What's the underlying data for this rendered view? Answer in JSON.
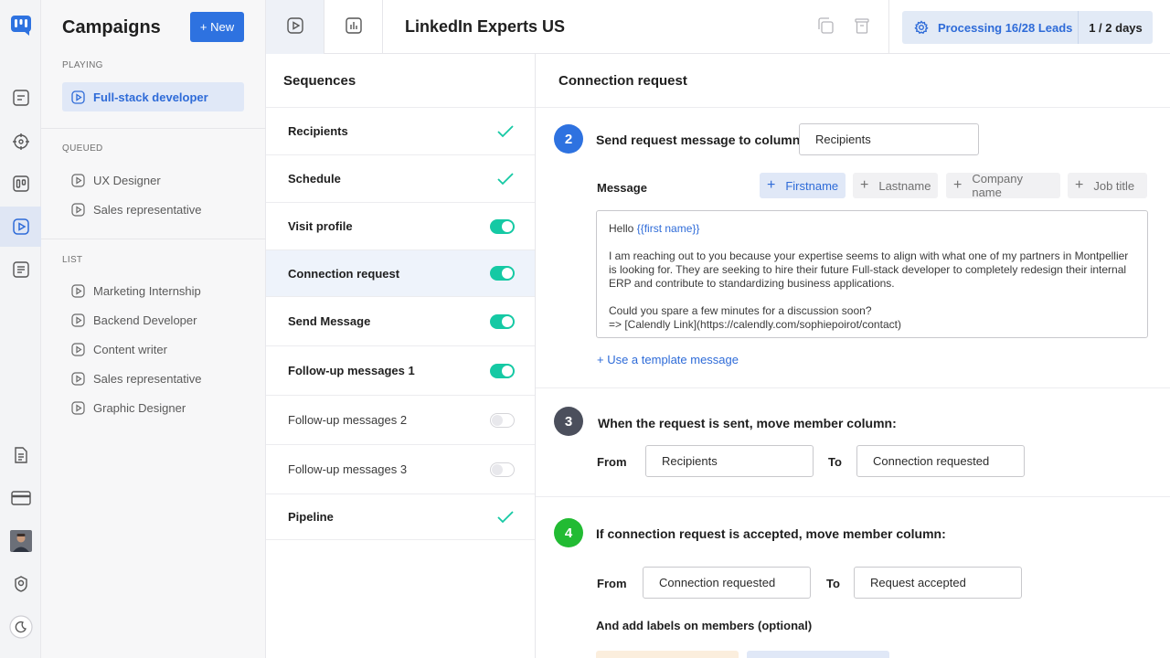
{
  "rail": {
    "icons": [
      "logo-icon",
      "messages-icon",
      "target-icon",
      "board-icon",
      "campaigns-icon",
      "list-icon",
      "documents-icon",
      "billing-icon",
      "avatar",
      "award-icon",
      "dark-mode-icon"
    ]
  },
  "campaigns": {
    "title": "Campaigns",
    "new_label": "+ New",
    "playing_label": "PLAYING",
    "playing": [
      "Full-stack developer"
    ],
    "queued_label": "QUEUED",
    "queued": [
      "UX Designer",
      "Sales representative"
    ],
    "list_label": "LIST",
    "list": [
      "Marketing Internship",
      "Backend Developer",
      "Content writer",
      "Sales representative",
      "Graphic Designer"
    ]
  },
  "topbar": {
    "title": "LinkedIn Experts US",
    "processing": "Processing 16/28 Leads",
    "days": "1 / 2 days"
  },
  "sequences": {
    "title": "Sequences",
    "items": [
      {
        "label": "Recipients",
        "state": "check"
      },
      {
        "label": "Schedule",
        "state": "check"
      },
      {
        "label": "Visit profile",
        "state": "on"
      },
      {
        "label": "Connection request",
        "state": "on"
      },
      {
        "label": "Send Message",
        "state": "on"
      },
      {
        "label": "Follow-up messages 1",
        "state": "on"
      },
      {
        "label": "Follow-up messages 2",
        "state": "off"
      },
      {
        "label": "Follow-up messages 3",
        "state": "off"
      },
      {
        "label": "Pipeline",
        "state": "check"
      }
    ]
  },
  "detail": {
    "title": "Connection request",
    "step2": {
      "num": "2",
      "text": "Send request message to column",
      "column": "Recipients"
    },
    "message_label": "Message",
    "chips": [
      "Firstname",
      "Lastname",
      "Company name",
      "Job title"
    ],
    "message": {
      "greeting": "Hello ",
      "variable": "{{first name}}",
      "para1": "I am reaching out to you because your expertise seems to align with what one of my partners in Montpellier is looking for. They are seeking to hire their future Full-stack developer to completely redesign their internal ERP and contribute to standardizing business applications.",
      "para2a": "Could you spare a few minutes for a discussion soon?",
      "para2b": "=> [Calendly Link](https://calendly.com/sophiepoirot/contact)"
    },
    "template_link": "+ Use a template message",
    "step3": {
      "num": "3",
      "text": "When the request is sent, move member column:",
      "from_label": "From",
      "from": "Recipients",
      "to_label": "To",
      "to": "Connection requested"
    },
    "step4": {
      "num": "4",
      "text": "If connection request is accepted, move member column:",
      "from_label": "From",
      "from": "Connection requested",
      "to_label": "To",
      "to": "Request accepted",
      "labels_text": "And add labels on members (optional)"
    }
  },
  "colors": {
    "accent": "#2e72e0",
    "toggle_on": "#15c9a4",
    "step2": "#2e72e0",
    "step3": "#4b4f5c",
    "step4": "#22bb33"
  }
}
